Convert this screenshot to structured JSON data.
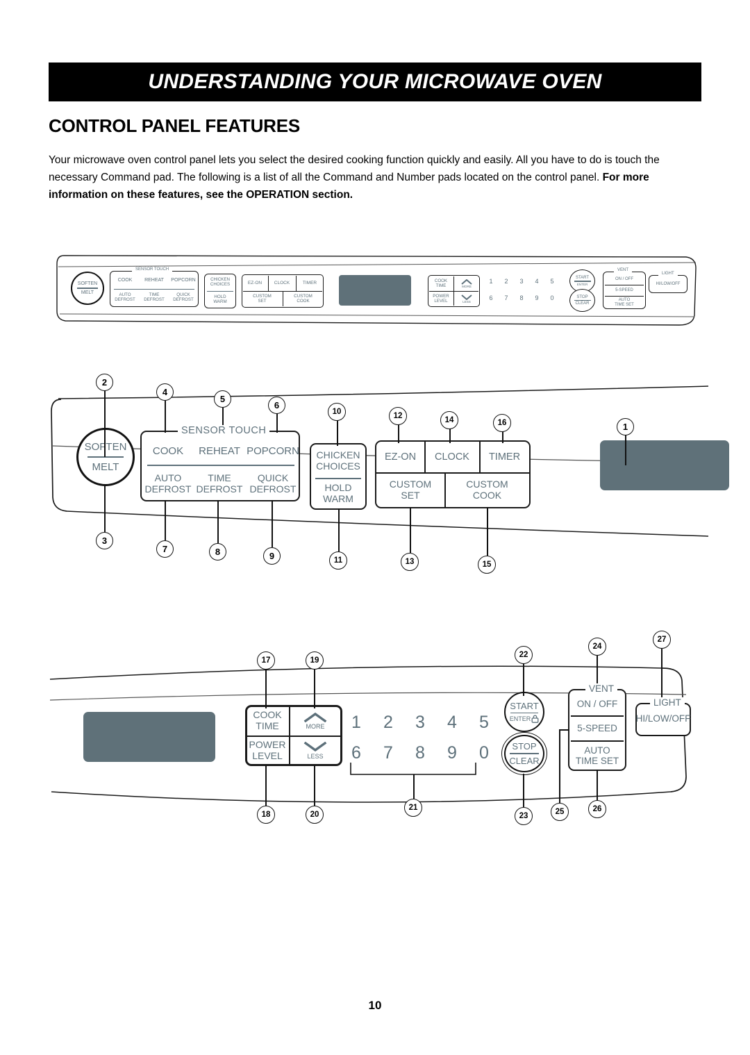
{
  "header": {
    "banner_title": "UNDERSTANDING YOUR MICROWAVE OVEN",
    "section_title": "CONTROL PANEL FEATURES"
  },
  "intro": {
    "line1": "Your microwave oven control panel lets you select the desired cooking function quickly and easily. All you have",
    "line2": "to do is touch the necessary Command pad. The following is a list of all the Command and Number pads",
    "line3": "located on the control panel. ",
    "line3_bold": "For more information on these features, see the OPERATION section."
  },
  "page": {
    "number": "10"
  },
  "colors": {
    "pad_text": "#5d707a",
    "display": "#5f7179",
    "outline": "#111111",
    "banner_bg": "#000000"
  },
  "panel": {
    "soften": "SOFTEN",
    "melt": "MELT",
    "sensor_touch_label": "SENSOR  TOUCH",
    "cook": "COOK",
    "reheat": "REHEAT",
    "popcorn": "POPCORN",
    "auto_defrost_l1": "AUTO",
    "auto_defrost_l2": "DEFROST",
    "time_defrost_l1": "TIME",
    "time_defrost_l2": "DEFROST",
    "quick_defrost_l1": "QUICK",
    "quick_defrost_l2": "DEFROST",
    "chicken_l1": "CHICKEN",
    "chicken_l2": "CHOICES",
    "hold_l1": "HOLD",
    "hold_l2": "WARM",
    "ez_on": "EZ-ON",
    "clock": "CLOCK",
    "timer": "TIMER",
    "custom_set_l1": "CUSTOM",
    "custom_set_l2": "SET",
    "custom_cook_l1": "CUSTOM",
    "custom_cook_l2": "COOK",
    "cook_time_l1": "COOK",
    "cook_time_l2": "TIME",
    "power_level_l1": "POWER",
    "power_level_l2": "LEVEL",
    "more": "MORE",
    "less": "LESS",
    "digits_row1": [
      "1",
      "2",
      "3",
      "4",
      "5"
    ],
    "digits_row2": [
      "6",
      "7",
      "8",
      "9",
      "0"
    ],
    "start": "START",
    "enter": "ENTER",
    "stop": "STOP",
    "clear": "CLEAR",
    "vent_label": "VENT",
    "vent_on_off": "ON / OFF",
    "vent_5speed": "5-SPEED",
    "vent_auto_l1": "AUTO",
    "vent_auto_l2": "TIME SET",
    "light_label": "LIGHT",
    "light_value": "HI/LOW/OFF"
  },
  "callouts": {
    "mid": [
      "1",
      "2",
      "3",
      "4",
      "5",
      "6",
      "7",
      "8",
      "9",
      "10",
      "11",
      "12",
      "13",
      "14",
      "15",
      "16"
    ],
    "bottom": [
      "17",
      "18",
      "19",
      "20",
      "21",
      "22",
      "23",
      "24",
      "25",
      "26",
      "27"
    ]
  }
}
